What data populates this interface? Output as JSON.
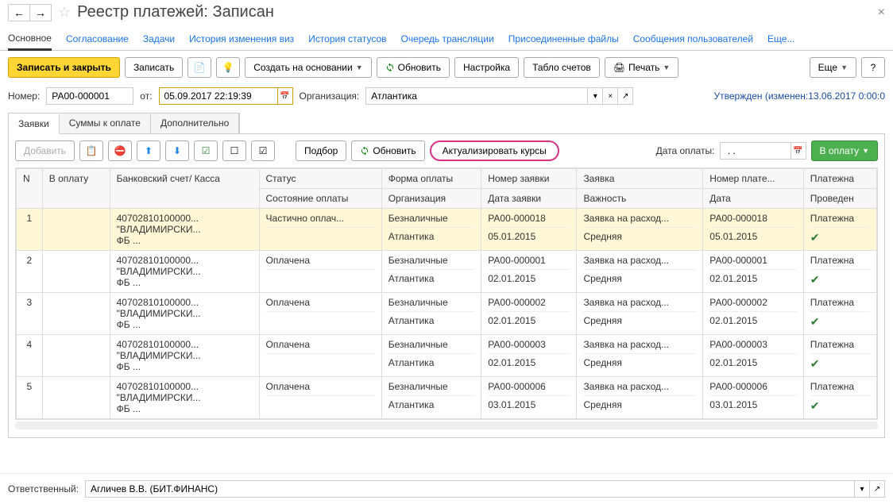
{
  "header": {
    "title": "Реестр платежей: Записан"
  },
  "main_tabs": [
    "Основное",
    "Согласование",
    "Задачи",
    "История изменения виз",
    "История статусов",
    "Очередь трансляции",
    "Присоединенные файлы",
    "Сообщения пользователей",
    "Еще..."
  ],
  "toolbar": {
    "save_close": "Записать и закрыть",
    "save": "Записать",
    "create_based": "Создать на основании",
    "refresh": "Обновить",
    "setup": "Настройка",
    "accounts": "Табло счетов",
    "print": "Печать",
    "more": "Еще",
    "help": "?"
  },
  "form": {
    "number_label": "Номер:",
    "number": "РА00-000001",
    "from_label": "от:",
    "date": "05.09.2017 22:19:39",
    "org_label": "Организация:",
    "org": "Атлантика",
    "status": "Утвержден (изменен:13.06.2017 0:00:0"
  },
  "sub_tabs": [
    "Заявки",
    "Суммы к оплате",
    "Дополнительно"
  ],
  "panel_toolbar": {
    "add": "Добавить",
    "select": "Подбор",
    "refresh": "Обновить",
    "update_rates": "Актуализировать курсы",
    "pay_date_label": "Дата оплаты:",
    "pay_date": " . .",
    "pay": "В оплату"
  },
  "table": {
    "headers": {
      "n": "N",
      "to_pay": "В оплату",
      "account": "Банковский счет/ Касса",
      "status": "Статус",
      "pay_state": "Состояние оплаты",
      "pay_form": "Форма оплаты",
      "org": "Организация",
      "req_num": "Номер заявки",
      "req_date": "Дата заявки",
      "request": "Заявка",
      "priority": "Важность",
      "pay_num": "Номер плате...",
      "date": "Дата",
      "payment": "Платежна",
      "done": "Проведен"
    },
    "rows": [
      {
        "n": "1",
        "account": "40702810100000...\n\"ВЛАДИМИРСКИ...\nФБ ...",
        "status": "Частично оплач...",
        "pay_form": "Безналичные",
        "org": "Атлантика",
        "req_num": "РА00-000018",
        "req_date": "05.01.2015",
        "request": "Заявка на расход...",
        "priority": "Средняя",
        "pay_num": "РА00-000018",
        "date": "05.01.2015",
        "payment": "Платежна",
        "done": true,
        "selected": true
      },
      {
        "n": "2",
        "account": "40702810100000...\n\"ВЛАДИМИРСКИ...\nФБ ...",
        "status": "Оплачена",
        "pay_form": "Безналичные",
        "org": "Атлантика",
        "req_num": "РА00-000001",
        "req_date": "02.01.2015",
        "request": "Заявка на расход...",
        "priority": "Средняя",
        "pay_num": "РА00-000001",
        "date": "02.01.2015",
        "payment": "Платежна",
        "done": true
      },
      {
        "n": "3",
        "account": "40702810100000...\n\"ВЛАДИМИРСКИ...\nФБ ...",
        "status": "Оплачена",
        "pay_form": "Безналичные",
        "org": "Атлантика",
        "req_num": "РА00-000002",
        "req_date": "02.01.2015",
        "request": "Заявка на расход...",
        "priority": "Средняя",
        "pay_num": "РА00-000002",
        "date": "02.01.2015",
        "payment": "Платежна",
        "done": true
      },
      {
        "n": "4",
        "account": "40702810100000...\n\"ВЛАДИМИРСКИ...\nФБ ...",
        "status": "Оплачена",
        "pay_form": "Безналичные",
        "org": "Атлантика",
        "req_num": "РА00-000003",
        "req_date": "02.01.2015",
        "request": "Заявка на расход...",
        "priority": "Средняя",
        "pay_num": "РА00-000003",
        "date": "02.01.2015",
        "payment": "Платежна",
        "done": true
      },
      {
        "n": "5",
        "account": "40702810100000...\n\"ВЛАДИМИРСКИ...\nФБ ...",
        "status": "Оплачена",
        "pay_form": "Безналичные",
        "org": "Атлантика",
        "req_num": "РА00-000006",
        "req_date": "03.01.2015",
        "request": "Заявка на расход...",
        "priority": "Средняя",
        "pay_num": "РА00-000006",
        "date": "03.01.2015",
        "payment": "Платежна",
        "done": true
      }
    ]
  },
  "footer": {
    "resp_label": "Ответственный:",
    "resp": "Агличев В.В. (БИТ.ФИНАНС)"
  }
}
